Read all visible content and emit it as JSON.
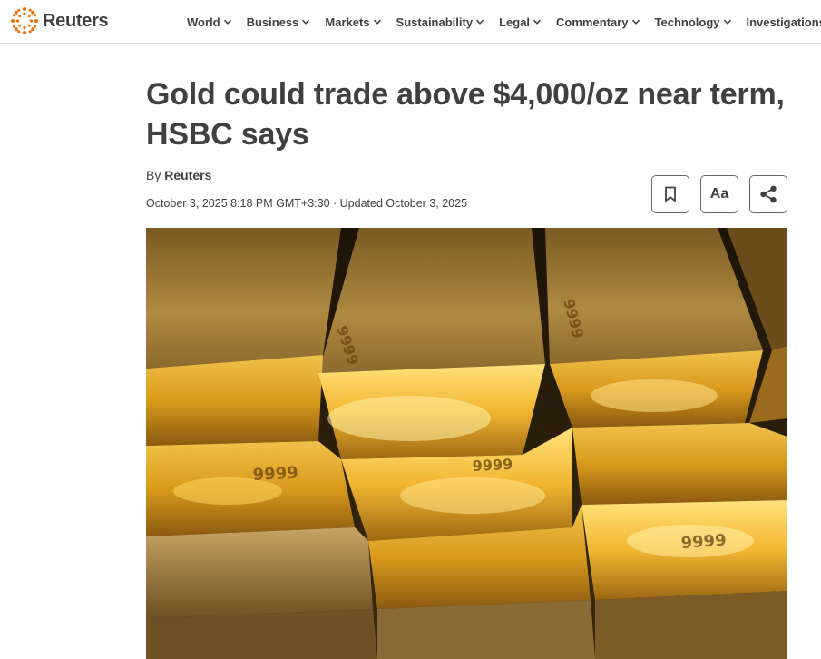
{
  "brand": {
    "name": "Reuters",
    "logo_color": "#ef6c00"
  },
  "nav": {
    "items": [
      {
        "label": "World",
        "has_dropdown": true
      },
      {
        "label": "Business",
        "has_dropdown": true
      },
      {
        "label": "Markets",
        "has_dropdown": true
      },
      {
        "label": "Sustainability",
        "has_dropdown": true
      },
      {
        "label": "Legal",
        "has_dropdown": true
      },
      {
        "label": "Commentary",
        "has_dropdown": true
      },
      {
        "label": "Technology",
        "has_dropdown": true
      },
      {
        "label": "Investigations",
        "has_dropdown": false
      }
    ]
  },
  "article": {
    "headline": "Gold could trade above $4,000/oz near term, HSBC says",
    "byline_prefix": "By",
    "author": "Reuters",
    "dateline": "October 3, 2025 8:18 PM GMT+3:30 · Updated October 3, 2025",
    "hero_image": {
      "subject": "gold bars",
      "stamp": "9999"
    }
  },
  "tools": {
    "bookmark_icon": "bookmark-icon",
    "text_size_label": "Aa",
    "share_icon": "share-icon"
  }
}
